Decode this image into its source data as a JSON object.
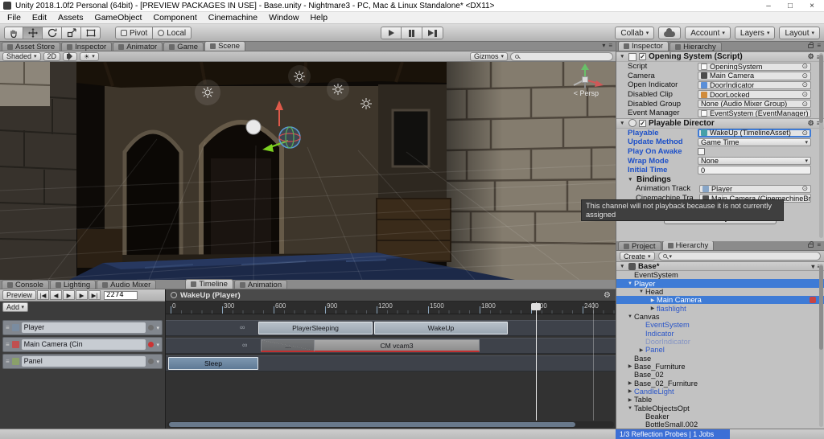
{
  "colors": {
    "accent_blue": "#3e7bd6",
    "prefab_blue": "#2a55c8",
    "record_red": "#c03030",
    "status_bar_blue": "#3c6fd6"
  },
  "icons": {
    "dropdown": "▾",
    "check": "✓",
    "gear": "⚙",
    "menu": "≡",
    "picker": "⊙",
    "foldout_open": "▼",
    "infinity": "∞",
    "minimize": "–",
    "maximize": "□",
    "close": "×"
  },
  "window": {
    "title": "Unity 2018.1.0f2 Personal (64bit) - [PREVIEW PACKAGES IN USE] - Base.unity - Nightmare3 - PC, Mac & Linux Standalone* <DX11>"
  },
  "menubar": {
    "items": [
      "File",
      "Edit",
      "Assets",
      "GameObject",
      "Component",
      "Cinemachine",
      "Window",
      "Help"
    ]
  },
  "toolbar": {
    "pivot": "Pivot",
    "local": "Local",
    "collab": "Collab",
    "account": "Account",
    "layers": "Layers",
    "layout": "Layout"
  },
  "scene": {
    "tabs": [
      "Asset Store",
      "Inspector",
      "Animator",
      "Game",
      "Scene"
    ],
    "shaded": "Shaded",
    "mode2d": "2D",
    "gizmos": "Gizmos",
    "persp": "< Persp"
  },
  "inspector": {
    "tab_inspector": "Inspector",
    "tab_hierarchy": "Hierarchy",
    "os_title": "Opening System (Script)",
    "os_rows": [
      {
        "label": "Script",
        "value": "OpeningSystem"
      },
      {
        "label": "Camera",
        "value": "Main Camera"
      },
      {
        "label": "Open Indicator",
        "value": "DoorIndicator"
      },
      {
        "label": "Disabled Clip",
        "value": "DoorLocked"
      },
      {
        "label": "Disabled Group",
        "value": "None (Audio Mixer Group)"
      },
      {
        "label": "Event Manager",
        "value": "EventSystem (EventManager)"
      }
    ],
    "pd_title": "Playable Director",
    "pd_rows": [
      {
        "label": "Playable",
        "value": "WakeUp (TimelineAsset)"
      },
      {
        "label": "Update Method",
        "value": "Game Time"
      },
      {
        "label": "Play On Awake",
        "value": ""
      },
      {
        "label": "W rap Mode",
        "value": "None"
      },
      {
        "label": "Initial Time",
        "value": "0"
      }
    ],
    "wrap_mode_label": "Wrap Mode",
    "bindings_label": "Bindings",
    "bindings": [
      {
        "label": "Animation Track",
        "value": "Player"
      },
      {
        "label": "Cinemachine Tra",
        "value": "Main Camera (CinemachineBr"
      }
    ],
    "tooltip": "This channel will not playback because it is not currently assigned",
    "add_component": "Add Component"
  },
  "hierarchy": {
    "tab_project": "Project",
    "tab_hierarchy": "Hierarchy",
    "create": "Create",
    "scene_name": "Base*",
    "items": [
      {
        "label": "EventSystem",
        "arrow": ""
      },
      {
        "label": "Player",
        "arrow": "▼"
      },
      {
        "label": "Head",
        "arrow": "▼"
      },
      {
        "label": "Main Camera",
        "arrow": "▶"
      },
      {
        "label": "flashlight",
        "arrow": "▶"
      },
      {
        "label": "Canvas",
        "arrow": "▼"
      },
      {
        "label": "EventSystem",
        "arrow": ""
      },
      {
        "label": "Indicator",
        "arrow": ""
      },
      {
        "label": "DoorIndicator",
        "arrow": ""
      },
      {
        "label": "Panel",
        "arrow": "▶"
      },
      {
        "label": "Base",
        "arrow": ""
      },
      {
        "label": "Base_Furniture",
        "arrow": "▶"
      },
      {
        "label": "Base_02",
        "arrow": ""
      },
      {
        "label": "Base_02_Furniture",
        "arrow": "▶"
      },
      {
        "label": "CandleLight",
        "arrow": "▶"
      },
      {
        "label": "Table",
        "arrow": "▶"
      },
      {
        "label": "TableObjectsOpt",
        "arrow": "▼"
      },
      {
        "label": "Beaker",
        "arrow": ""
      },
      {
        "label": "BottleSmall.002",
        "arrow": ""
      }
    ]
  },
  "timeline": {
    "tabs": [
      "Console",
      "Lighting",
      "Audio Mixer",
      "Timeline",
      "Animation"
    ],
    "preview": "Preview",
    "transport": [
      "|◀",
      "◀",
      "▶",
      "▶",
      "▶|"
    ],
    "frame": "2274",
    "add": "Add",
    "title": "WakeUp (Player)",
    "ruler": [
      "0",
      "300",
      "600",
      "900",
      "1200",
      "1500",
      "1800",
      "2100",
      "2400"
    ],
    "tracks": [
      "Player",
      "Main Camera (Cin",
      "Panel"
    ],
    "clips": {
      "sleeping": "PlayerSleeping",
      "wakeup": "WakeUp",
      "blend": "...",
      "vcam": "CM vcam3",
      "sleep": "Sleep"
    }
  },
  "statusbar": {
    "task": "1/3 Reflection Probes | 1 Jobs"
  }
}
